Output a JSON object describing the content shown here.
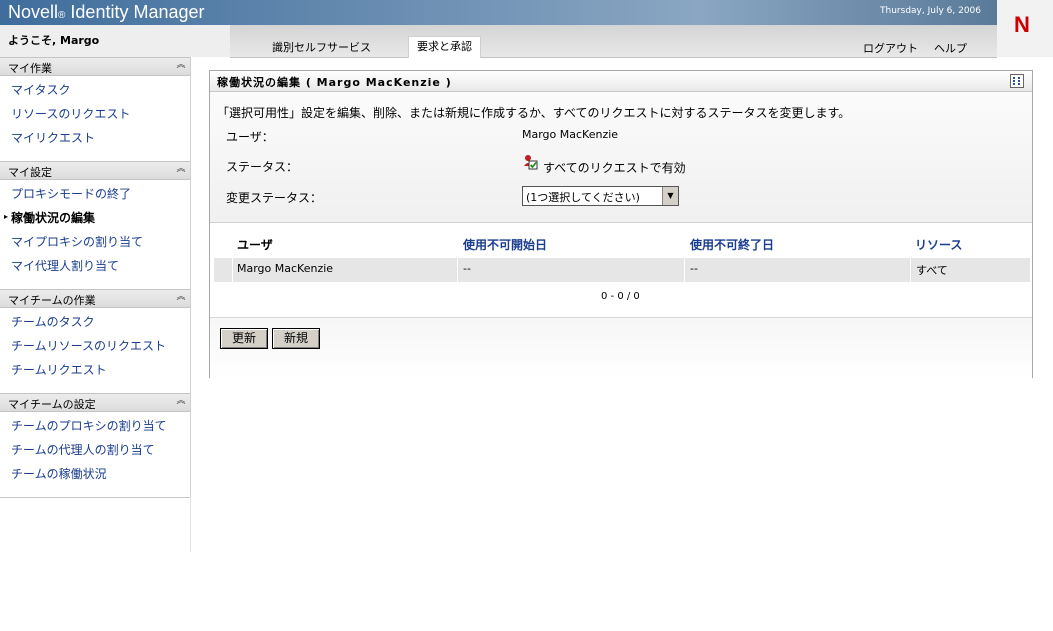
{
  "app": {
    "brand": "Novell",
    "reg": "®",
    "product": "Identity Manager",
    "date": "Thursday, July 6, 2006",
    "logo": "N"
  },
  "header": {
    "welcome": "ようこそ, Margo",
    "tabs": [
      {
        "label": "識別セルフサービス"
      },
      {
        "label": "要求と承認"
      }
    ],
    "logout": "ログアウト",
    "help": "ヘルプ"
  },
  "sidebar": {
    "sections": [
      {
        "title": "マイ作業",
        "items": [
          "マイタスク",
          "リソースのリクエスト",
          "マイリクエスト"
        ]
      },
      {
        "title": "マイ設定",
        "items": [
          "プロキシモードの終了",
          "稼働状況の編集",
          "マイプロキシの割り当て",
          "マイ代理人割り当て"
        ]
      },
      {
        "title": "マイチームの作業",
        "items": [
          "チームのタスク",
          "チームリソースのリクエスト",
          "チームリクエスト"
        ]
      },
      {
        "title": "マイチームの設定",
        "items": [
          "チームのプロキシの割り当て",
          "チームの代理人の割り当て",
          "チームの稼働状況"
        ]
      }
    ]
  },
  "panel": {
    "title": "稼働状況の編集 ( Margo MacKenzie )",
    "description": "「選択可用性」設定を編集、削除、または新規に作成するか、すべてのリクエストに対するステータスを変更します。",
    "user_label": "ユーザ：",
    "user_value": "Margo MacKenzie",
    "status_label": "ステータス：",
    "status_value": "すべてのリクエストで有効",
    "change_label": "変更ステータス：",
    "change_select": "(1つ選択してください)",
    "table": {
      "headers": [
        "ユーザ",
        "使用不可開始日",
        "使用不可終了日",
        "リソース"
      ],
      "rows": [
        [
          "Margo MacKenzie",
          "--",
          "--",
          "すべて"
        ]
      ]
    },
    "pager": "0 - 0 / 0",
    "update_button": "更新",
    "new_button": "新規"
  }
}
